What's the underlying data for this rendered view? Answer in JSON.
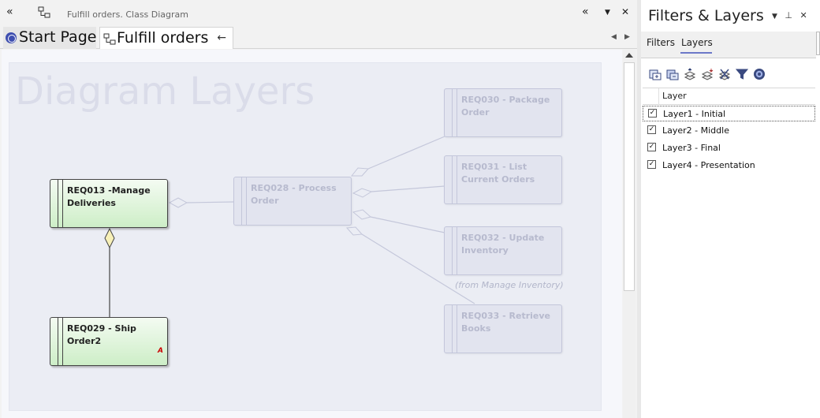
{
  "titlebar": {
    "title": "Fulfill orders.  Class Diagram",
    "collapse_left_icon": "«",
    "collapse_right_icon": "«",
    "menu_icon": "▼",
    "close_icon": "✕"
  },
  "tabs": {
    "start_page": "Start Page",
    "fulfill_orders": "Fulfill orders",
    "pin_icon": "←",
    "prev_icon": "◀",
    "next_icon": "▶"
  },
  "diagram": {
    "title": "Diagram Layers",
    "from_note": "(from Manage Inventory)",
    "elements": {
      "req013": "REQ013 -Manage\nDeliveries",
      "req029": "REQ029 - Ship\nOrder2",
      "req029_badge": "A",
      "req028": "REQ028 - Process\nOrder",
      "req030": "REQ030 - Package\nOrder",
      "req031": "REQ031 - List\nCurrent Orders",
      "req032": "REQ032 - Update\nInventory",
      "req033": "REQ033 - Retrieve\nBooks"
    }
  },
  "panel": {
    "title": "Filters & Layers",
    "menu_icon": "▼",
    "pin_icon": "⊥",
    "close_icon": "✕",
    "tabs": {
      "filters": "Filters",
      "layers": "Layers"
    },
    "column_header": "Layer",
    "layers": [
      {
        "label": "Layer1 - Initial",
        "checked": true
      },
      {
        "label": "Layer2 - Middle",
        "checked": true
      },
      {
        "label": "Layer3 - Final",
        "checked": true
      },
      {
        "label": "Layer4 - Presentation",
        "checked": true
      }
    ],
    "check_mark": "✓"
  },
  "colors": {
    "active_element": "#cdeec7",
    "faded_element": "#e2e4ef",
    "layers_tab_accent": "#6c78c8"
  }
}
